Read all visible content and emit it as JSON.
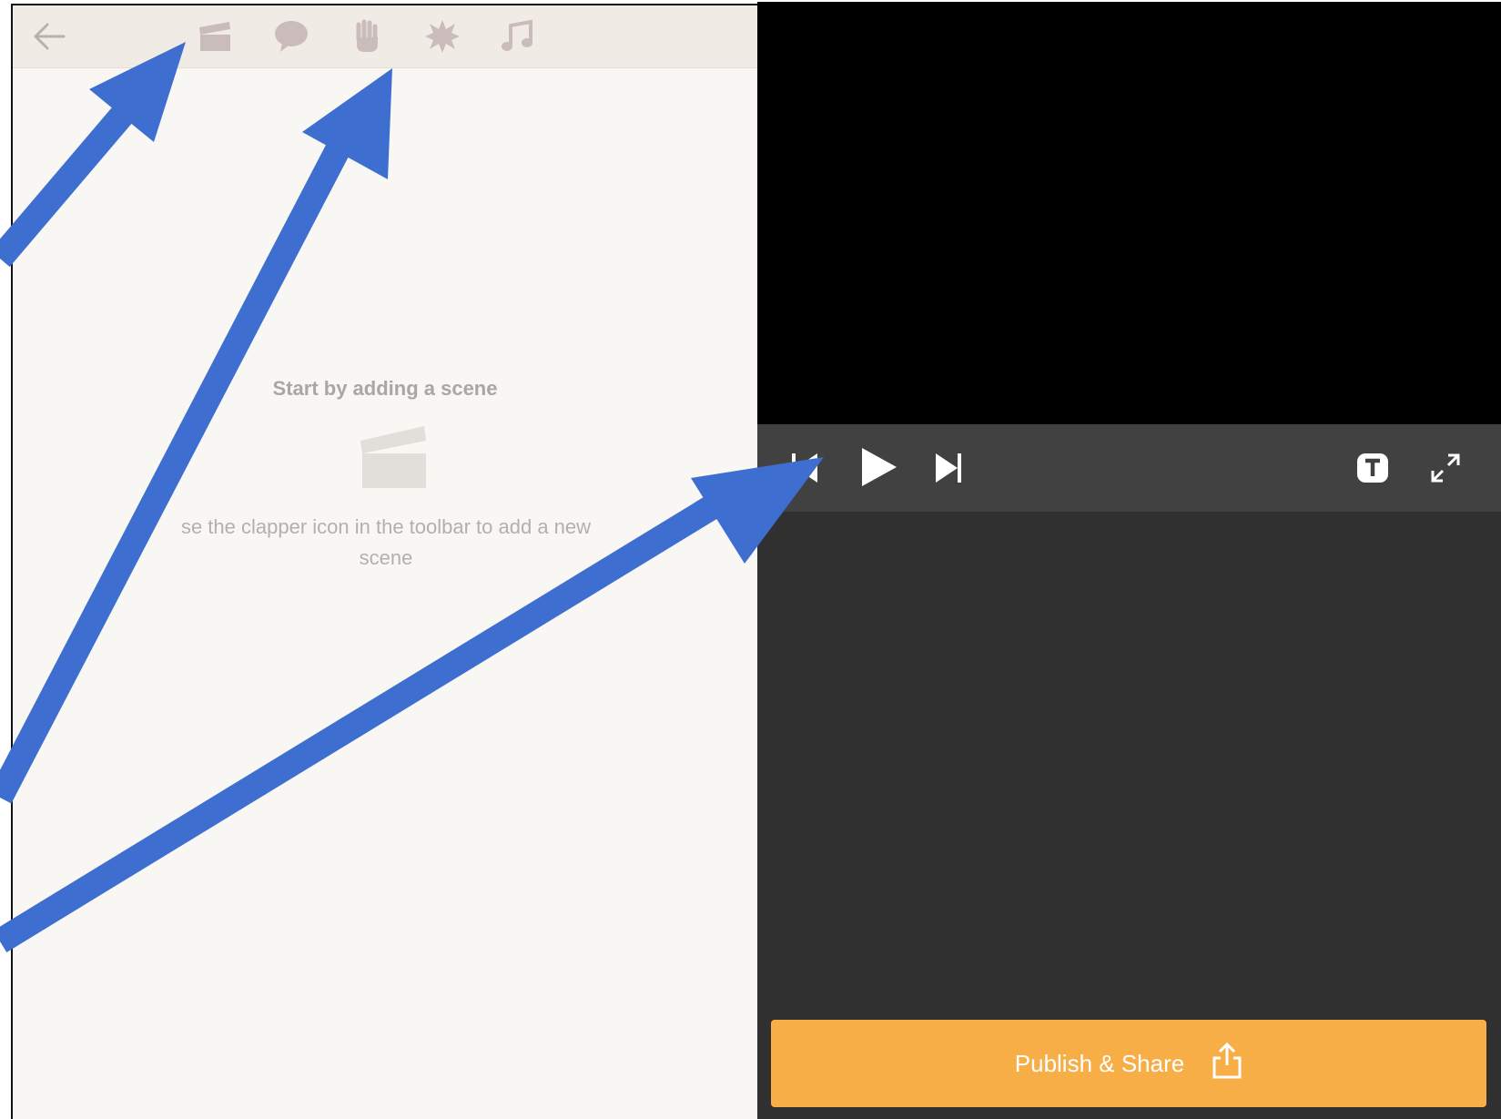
{
  "toolbar": {
    "icons": [
      "back-arrow-icon",
      "clapper-icon",
      "speech-bubble-icon",
      "hand-icon",
      "starburst-icon",
      "music-note-icon"
    ]
  },
  "empty_state": {
    "title": "Start by adding a scene",
    "description": "se the clapper icon in the toolbar to add a new scene"
  },
  "player": {
    "controls": [
      "skip-back-icon",
      "play-icon",
      "skip-forward-icon",
      "text-toggle-icon",
      "fullscreen-icon"
    ]
  },
  "publish": {
    "label": "Publish & Share"
  },
  "colors": {
    "accent": "#f7ae46",
    "arrow": "#3e6fd0",
    "panel_bg": "#f9f7f3",
    "toolbar_bg": "#f1ebe5",
    "player_bg": "#303030",
    "controls_bg": "#424142"
  }
}
